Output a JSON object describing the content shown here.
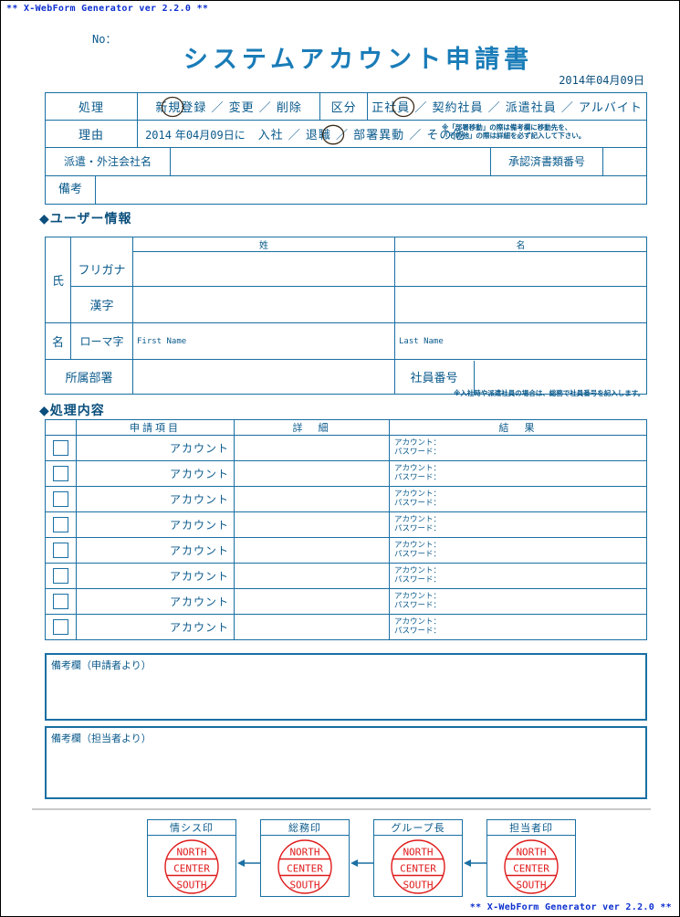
{
  "generator": {
    "header": "** X-WebForm Generator ver 2.2.0 **",
    "footer": "** X-WebForm Generator ver 2.2.0 **"
  },
  "header": {
    "no_label": "No：",
    "title": "システムアカウント申請書",
    "date": "2014年04月09日"
  },
  "top_table": {
    "process_label": "処理",
    "process_options": "新規登録 ／ 変更 ／ 削除",
    "process_selected": "新規登録",
    "category_label": "区分",
    "category_options": "正社員 ／ 契約社員 ／ 派遣社員 ／ アルバイト",
    "category_selected": "正社員",
    "reason_label": "理由",
    "reason_year": "2014",
    "reason_year_unit": "年",
    "reason_month": "04",
    "reason_month_unit": "月",
    "reason_day": "09",
    "reason_day_unit": "日に",
    "reason_options": "入社 ／ 退職 ／ 部署異動 ／ その他",
    "reason_selected": "入社",
    "reason_note_line1": "※「部署移動」の際は備考欄に移動先を、",
    "reason_note_line2": "「その他」の際は詳細を必ず記入して下さい。",
    "company_label": "派遣・外注会社名",
    "company_value": "",
    "approval_no_label": "承認済書類番号",
    "approval_no_value": "",
    "remarks_label": "備考",
    "remarks_value": ""
  },
  "user_section": {
    "heading": "◆ユーザー情報",
    "name_label_top": "氏",
    "name_label_bottom": "名",
    "col_sei": "姓",
    "col_mei": "名",
    "row_furigana": "フリガナ",
    "row_kanji": "漢字",
    "row_romaji": "ローマ字",
    "romaji_first_hint": "First Name",
    "romaji_last_hint": "Last Name",
    "department_label": "所属部署",
    "department_value": "",
    "employee_no_label": "社員番号",
    "employee_no_value": "",
    "note": "※入社時や派遣社員の場合は、総務で社員番号を記入します。"
  },
  "process_section": {
    "heading": "◆処理内容",
    "columns": [
      "",
      "申請項目",
      "詳　細",
      "結　果"
    ],
    "rows": [
      {
        "checked": false,
        "item": "アカウント",
        "detail": "",
        "result_account": "アカウント：",
        "result_password": "パスワード："
      },
      {
        "checked": false,
        "item": "アカウント",
        "detail": "",
        "result_account": "アカウント：",
        "result_password": "パスワード："
      },
      {
        "checked": false,
        "item": "アカウント",
        "detail": "",
        "result_account": "アカウント：",
        "result_password": "パスワード："
      },
      {
        "checked": false,
        "item": "アカウント",
        "detail": "",
        "result_account": "アカウント：",
        "result_password": "パスワード："
      },
      {
        "checked": false,
        "item": "アカウント",
        "detail": "",
        "result_account": "アカウント：",
        "result_password": "パスワード："
      },
      {
        "checked": false,
        "item": "アカウント",
        "detail": "",
        "result_account": "アカウント：",
        "result_password": "パスワード："
      },
      {
        "checked": false,
        "item": "アカウント",
        "detail": "",
        "result_account": "アカウント：",
        "result_password": "パスワード："
      },
      {
        "checked": false,
        "item": "アカウント",
        "detail": "",
        "result_account": "アカウント：",
        "result_password": "パスワード："
      }
    ],
    "remark_applicant": "備考欄（申請者より）",
    "remark_applicant_value": "",
    "remark_staff": "備考欄（担当者より）",
    "remark_staff_value": ""
  },
  "stamps": {
    "seal_lines": [
      "NORTH",
      "CENTER",
      "SOUTH"
    ],
    "boxes": [
      {
        "caption": "情シス印"
      },
      {
        "caption": "総務印"
      },
      {
        "caption": "グループ長"
      },
      {
        "caption": "担当者印"
      }
    ]
  },
  "colors": {
    "ink": "#0a5a8c",
    "line": "#1a6fa3",
    "title": "#1a7cb8",
    "generator": "#0b2fd0",
    "seal": "#e01b1b",
    "arrow": "#1a6fa3",
    "separator": "#c9c9c9",
    "circle": "#3a2a18"
  }
}
